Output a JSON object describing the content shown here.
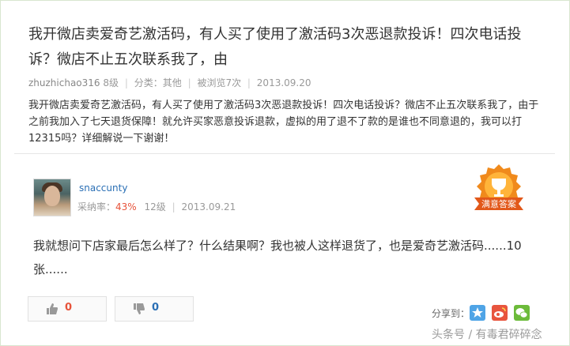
{
  "question": {
    "title": "我开微店卖爱奇艺激活码，有人买了使用了激活码3次恶退款投诉！四次电话投诉？微店不止五次联系我了，由",
    "user": "zhuzhichao316",
    "level": "8级",
    "category": "分类：其他",
    "views": "被浏览7次",
    "date": "2013.09.20",
    "body": "我开微店卖爱奇艺激活码，有人买了使用了激活码3次恶退款投诉！四次电话投诉？微店不止五次联系我了，由于之前我加入了七天退货保障！就允许买家恶意投诉退款，虚拟的用了退不了款的是谁也不同意退的，我可以打12315吗？详细解说一下谢谢！"
  },
  "answer": {
    "user": "snaccunty",
    "rate_label": "采纳率：",
    "rate_value": "43%",
    "level": "12级",
    "date": "2013.09.21",
    "badge_text": "满意答案",
    "body": "我就想问下店家最后怎么样了？什么结果啊？我也被人这样退货了，也是爱奇艺激活码......10张......"
  },
  "votes": {
    "up": "0",
    "down": "0"
  },
  "share": {
    "label": "分享到：",
    "icons": [
      "qzone-icon",
      "weibo-icon",
      "wechat-icon"
    ]
  },
  "watermark": "头条号 / 有毒君碎碎念",
  "colors": {
    "accent_red": "#e7533a",
    "link_blue": "#2a6fb5",
    "badge_orange": "#f08a1c"
  }
}
